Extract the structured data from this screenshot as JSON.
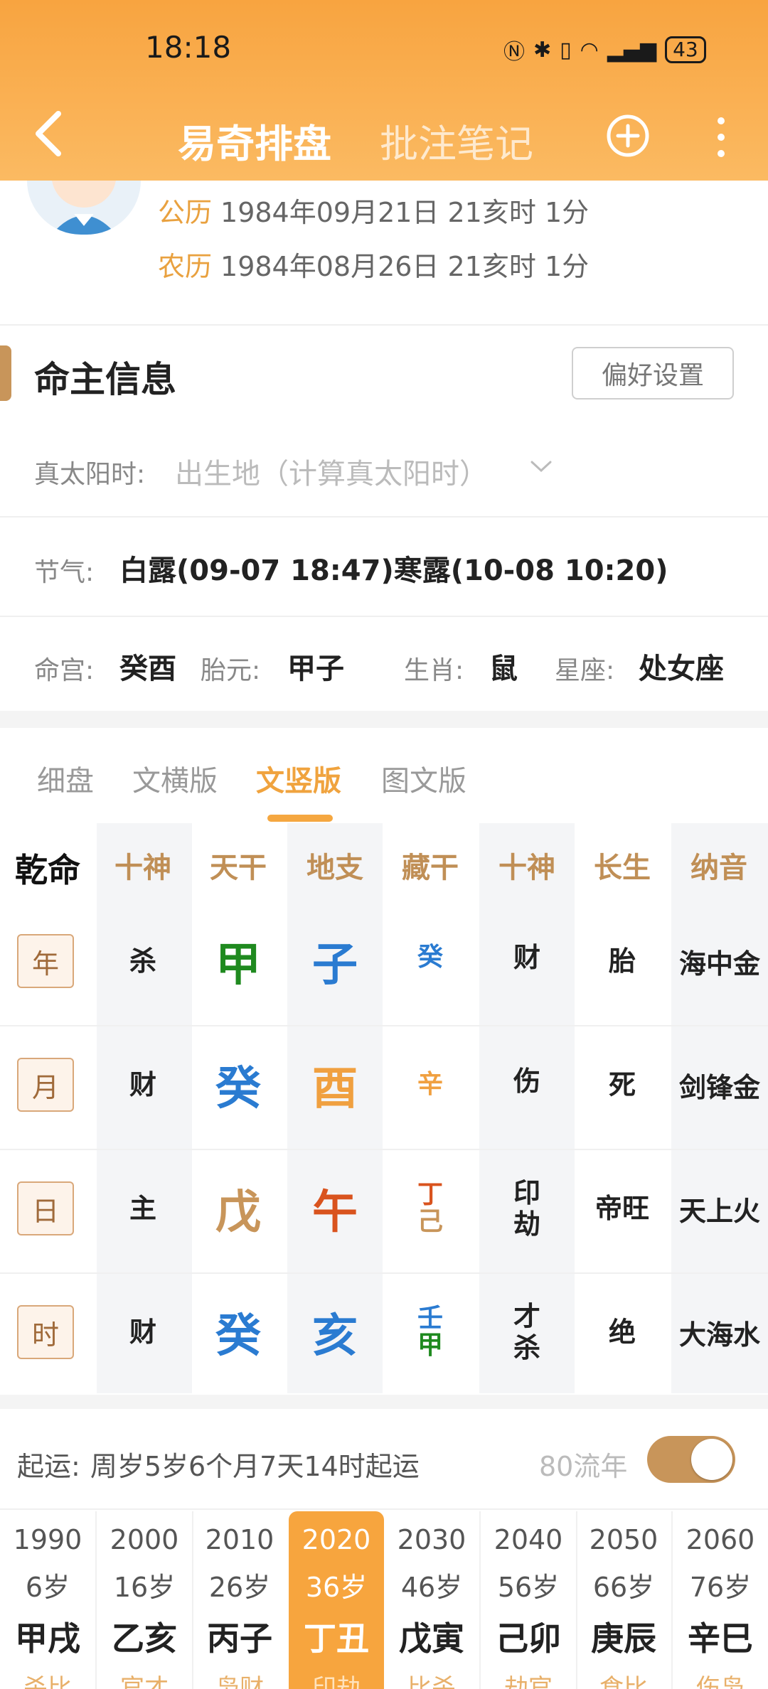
{
  "status": {
    "time": "18:18",
    "battery": "43"
  },
  "nav": {
    "tab_active": "易奇排盘",
    "tab_inactive": "批注笔记"
  },
  "birth": {
    "solar_tag": "公历",
    "solar_value": "1984年09月21日 21亥时 1分",
    "lunar_tag": "农历",
    "lunar_value": "1984年08月26日 21亥时 1分"
  },
  "section": {
    "title": "命主信息",
    "pref_button": "偏好设置"
  },
  "info": {
    "true_solar_label": "真太阳时:",
    "true_solar_placeholder": "出生地（计算真太阳时）",
    "solar_term_label": "节气:",
    "solar_term_value": "白露(09-07 18:47)寒露(10-08 10:20)",
    "minggong_label": "命宫:",
    "minggong_value": "癸酉",
    "taiyuan_label": "胎元:",
    "taiyuan_value": "甲子",
    "shengxiao_label": "生肖:",
    "shengxiao_value": "鼠",
    "xingzuo_label": "星座:",
    "xingzuo_value": "处女座"
  },
  "view_tabs": [
    "细盘",
    "文横版",
    "文竖版",
    "图文版"
  ],
  "view_tab_active": "文竖版",
  "chart": {
    "corner": "乾命",
    "headers": [
      "十神",
      "天干",
      "地支",
      "藏干",
      "十神",
      "长生",
      "纳音"
    ],
    "rows": [
      {
        "label": "年",
        "shishen_top": "杀",
        "gan": "甲",
        "zhi": "子",
        "canggan": [
          "癸"
        ],
        "shishen_bottom": [
          "财"
        ],
        "changsheng": "胎",
        "nayin": "海中金"
      },
      {
        "label": "月",
        "shishen_top": "财",
        "gan": "癸",
        "zhi": "酉",
        "canggan": [
          "辛"
        ],
        "shishen_bottom": [
          "伤"
        ],
        "changsheng": "死",
        "nayin": "剑锋金"
      },
      {
        "label": "日",
        "shishen_top": "主",
        "gan": "戊",
        "zhi": "午",
        "canggan": [
          "丁",
          "己"
        ],
        "shishen_bottom": [
          "印",
          "劫"
        ],
        "changsheng": "帝旺",
        "nayin": "天上火"
      },
      {
        "label": "时",
        "shishen_top": "财",
        "gan": "癸",
        "zhi": "亥",
        "canggan": [
          "壬",
          "甲"
        ],
        "shishen_bottom": [
          "才",
          "杀"
        ],
        "changsheng": "绝",
        "nayin": "大海水"
      }
    ]
  },
  "qiyun": {
    "label": "起运:",
    "value": "周岁5岁6个月7天14时起运",
    "liunian_label": "80流年",
    "toggle_on": true
  },
  "dayun": [
    {
      "year": "1990",
      "age": "6岁",
      "ganzhi": "甲戌",
      "shishen": "杀比"
    },
    {
      "year": "2000",
      "age": "16岁",
      "ganzhi": "乙亥",
      "shishen": "官才"
    },
    {
      "year": "2010",
      "age": "26岁",
      "ganzhi": "丙子",
      "shishen": "枭财"
    },
    {
      "year": "2020",
      "age": "36岁",
      "ganzhi": "丁丑",
      "shishen": "印劫"
    },
    {
      "year": "2030",
      "age": "46岁",
      "ganzhi": "戊寅",
      "shishen": "比杀"
    },
    {
      "year": "2040",
      "age": "56岁",
      "ganzhi": "己卯",
      "shishen": "劫官"
    },
    {
      "year": "2050",
      "age": "66岁",
      "ganzhi": "庚辰",
      "shishen": "食比"
    },
    {
      "year": "2060",
      "age": "76岁",
      "ganzhi": "辛巳",
      "shishen": "伤枭"
    }
  ],
  "dayun_active_index": 3
}
